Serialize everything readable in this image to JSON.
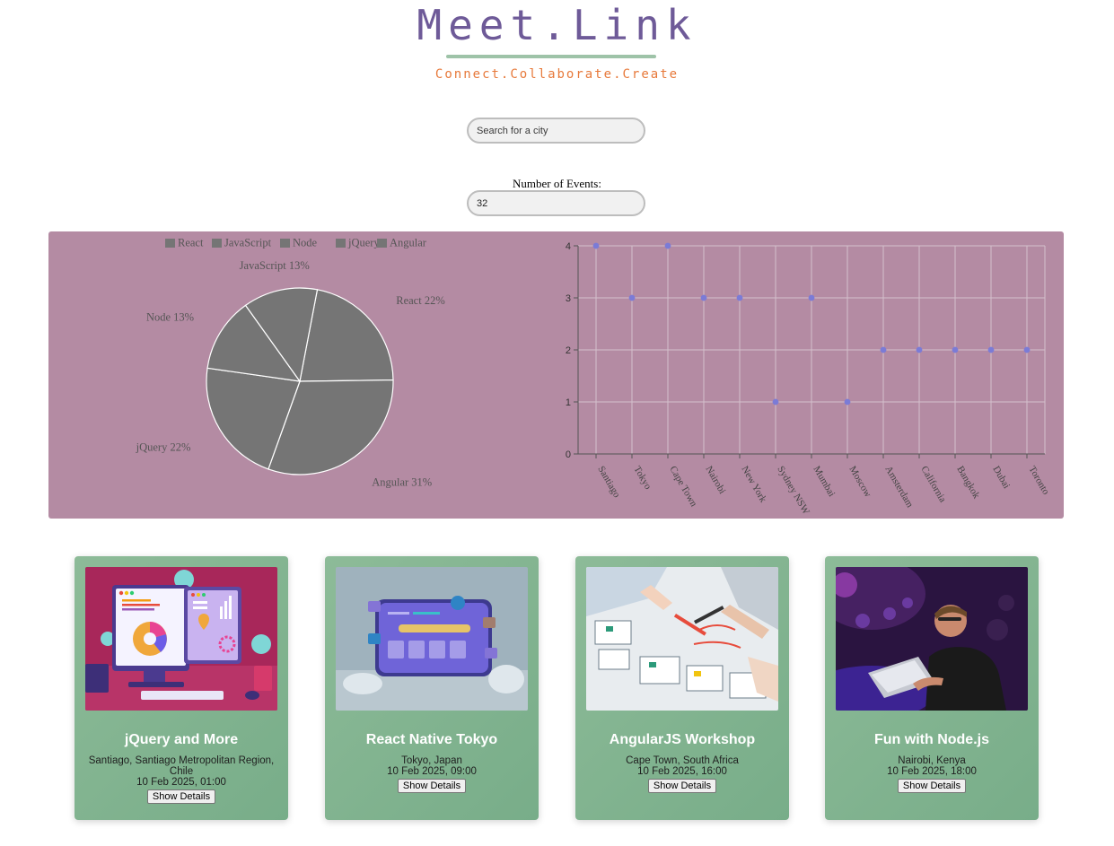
{
  "header": {
    "logo_title": "Meet.Link",
    "logo_tagline": "Connect.Collaborate.Create"
  },
  "search": {
    "placeholder": "Search for a city",
    "value": ""
  },
  "event_count": {
    "label": "Number of Events:",
    "value": "32"
  },
  "colors": {
    "chart_background": "#b48ba3",
    "pie_fill": "#757575",
    "scatter_point": "#7b7bd6",
    "card_green": "#82b491",
    "logo_purple": "#6e5a98",
    "tagline_orange": "#e7793a"
  },
  "chart_data": [
    {
      "type": "pie",
      "legend": [
        "React",
        "JavaScript",
        "Node",
        "jQuery",
        "Angular"
      ],
      "legend_position": "top",
      "slices": [
        {
          "label": "React",
          "value": 22
        },
        {
          "label": "Angular",
          "value": 31
        },
        {
          "label": "jQuery",
          "value": 22
        },
        {
          "label": "Node",
          "value": 13
        },
        {
          "label": "JavaScript",
          "value": 13
        }
      ],
      "slice_labels": [
        "React 22%",
        "Angular 31%",
        "jQuery 22%",
        "Node 13%",
        "JavaScript 13%"
      ]
    },
    {
      "type": "scatter",
      "categories": [
        "Santiago",
        "Tokyo",
        "Cape Town",
        "Nairobi",
        "New York",
        "Sydney NSW",
        "Mumbai",
        "Moscow",
        "Amsterdam",
        "California",
        "Bangkok",
        "Dubai",
        "Toronto"
      ],
      "values": [
        4,
        3,
        4,
        3,
        3,
        1,
        3,
        1,
        2,
        2,
        2,
        2,
        2
      ],
      "ylim": [
        0,
        4
      ],
      "yticks": [
        "0",
        "1",
        "2",
        "3",
        "4"
      ],
      "grid": true
    }
  ],
  "events": [
    {
      "title": "jQuery and More",
      "location": "Santiago, Santiago Metropolitan Region, Chile",
      "datetime": "10 Feb 2025, 01:00",
      "button_label": "Show Details",
      "image": "devices-dashboard"
    },
    {
      "title": "React Native Tokyo",
      "location": "Tokyo, Japan",
      "datetime": "10 Feb 2025, 09:00",
      "button_label": "Show Details",
      "image": "browser-window"
    },
    {
      "title": "AngularJS Workshop",
      "location": "Cape Town, South Africa",
      "datetime": "10 Feb 2025, 16:00",
      "button_label": "Show Details",
      "image": "wireframe-sketching"
    },
    {
      "title": "Fun with Node.js",
      "location": "Nairobi, Kenya",
      "datetime": "10 Feb 2025, 18:00",
      "button_label": "Show Details",
      "image": "developer-laptop"
    }
  ]
}
